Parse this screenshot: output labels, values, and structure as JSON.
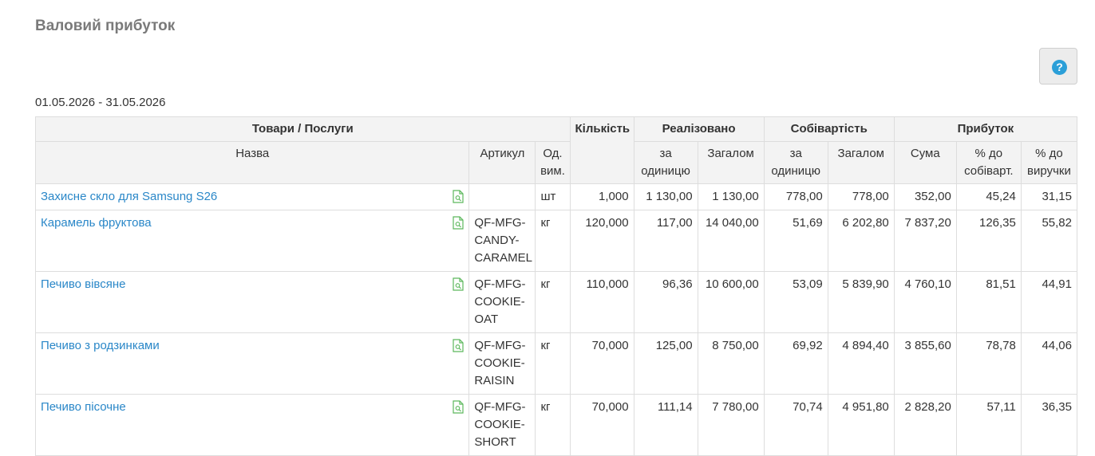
{
  "title": "Валовий прибуток",
  "help_icon": "question-circle-icon",
  "date_range": "01.05.2026 - 31.05.2026",
  "header": {
    "group_goods": "Товари / Послуги",
    "quantity": "Кількість",
    "sold": "Реалізовано",
    "cost": "Собівартість",
    "profit": "Прибуток",
    "name": "Назва",
    "sku": "Артикул",
    "unit": "Од. вим.",
    "sold_per_unit": "за одиницю",
    "sold_total": "Загалом",
    "cost_per_unit": "за одиницю",
    "cost_total": "Загалом",
    "profit_sum": "Сума",
    "profit_pct_cost": "% до собіварт.",
    "profit_pct_revenue": "% до виручки"
  },
  "rows": [
    {
      "name": "Захисне скло для Samsung S26",
      "sku": "",
      "unit": "шт",
      "qty": "1,000",
      "sold_unit": "1 130,00",
      "sold_total": "1 130,00",
      "cost_unit": "778,00",
      "cost_total": "778,00",
      "profit": "352,00",
      "pct_cost": "45,24",
      "pct_rev": "31,15"
    },
    {
      "name": "Карамель фруктова",
      "sku": "QF-MFG-CANDY-CARAMEL",
      "unit": "кг",
      "qty": "120,000",
      "sold_unit": "117,00",
      "sold_total": "14 040,00",
      "cost_unit": "51,69",
      "cost_total": "6 202,80",
      "profit": "7 837,20",
      "pct_cost": "126,35",
      "pct_rev": "55,82"
    },
    {
      "name": "Печиво вівсяне",
      "sku": "QF-MFG-COOKIE-OAT",
      "unit": "кг",
      "qty": "110,000",
      "sold_unit": "96,36",
      "sold_total": "10 600,00",
      "cost_unit": "53,09",
      "cost_total": "5 839,90",
      "profit": "4 760,10",
      "pct_cost": "81,51",
      "pct_rev": "44,91"
    },
    {
      "name": "Печиво з родзинками",
      "sku": "QF-MFG-COOKIE-RAISIN",
      "unit": "кг",
      "qty": "70,000",
      "sold_unit": "125,00",
      "sold_total": "8 750,00",
      "cost_unit": "69,92",
      "cost_total": "4 894,40",
      "profit": "3 855,60",
      "pct_cost": "78,78",
      "pct_rev": "44,06"
    },
    {
      "name": "Печиво пісочне",
      "sku": "QF-MFG-COOKIE-SHORT",
      "unit": "кг",
      "qty": "70,000",
      "sold_unit": "111,14",
      "sold_total": "7 780,00",
      "cost_unit": "70,74",
      "cost_total": "4 951,80",
      "profit": "2 828,20",
      "pct_cost": "57,11",
      "pct_rev": "36,35"
    }
  ]
}
